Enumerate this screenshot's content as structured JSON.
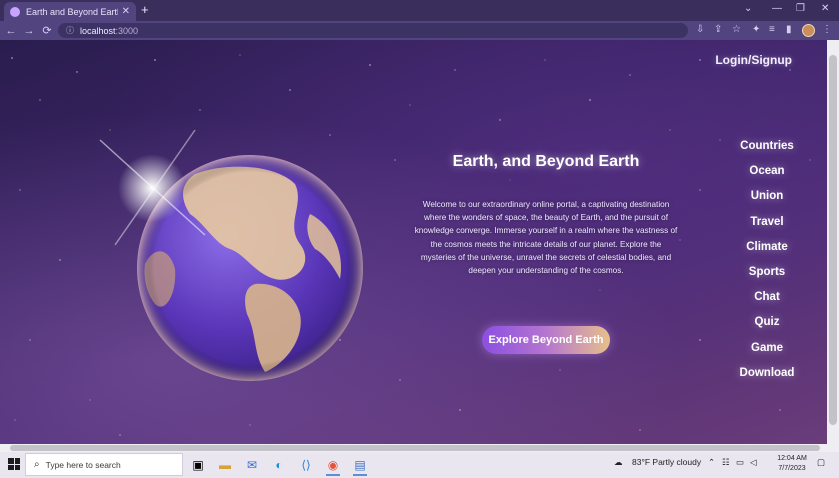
{
  "browser": {
    "tab_title": "Earth and Beyond Earth",
    "tab_close": "✕",
    "new_tab": "+",
    "url_host": "localhost",
    "url_port": ":3000",
    "window_controls": [
      "⌄",
      "—",
      "❐",
      "✕"
    ]
  },
  "page": {
    "login_label": "Login/Signup",
    "title": "Earth, and Beyond Earth",
    "intro": "Welcome to our extraordinary online portal, a captivating destination where the wonders of space, the beauty of Earth, and the pursuit of knowledge converge. Immerse yourself in a realm where the vastness of the cosmos meets the intricate details of our planet. Explore the mysteries of the universe, unravel the secrets of celestial bodies, and deepen your understanding of the cosmos.",
    "cta_label": "Explore Beyond Earth",
    "nav": [
      "Countries",
      "Ocean",
      "Union",
      "Travel",
      "Climate",
      "Sports",
      "Chat",
      "Quiz",
      "Game",
      "Download"
    ]
  },
  "taskbar": {
    "search_placeholder": "Type here to search",
    "weather": "83°F  Partly cloudy",
    "time": "12:04 AM",
    "date": "7/7/2023"
  }
}
